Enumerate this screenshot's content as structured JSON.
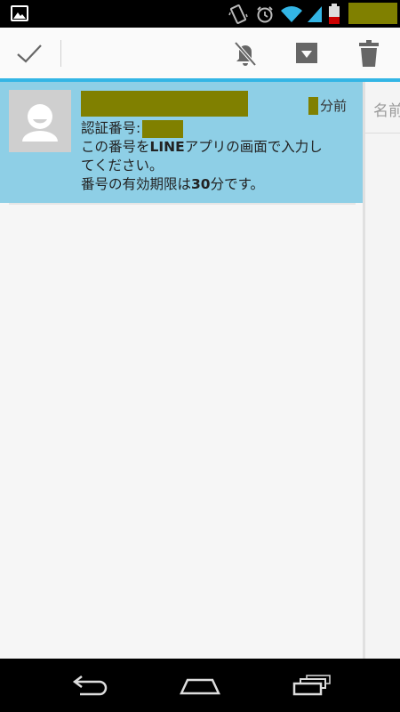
{
  "status_bar": {
    "icons": [
      "gallery-icon",
      "vibrate-icon",
      "alarm-icon",
      "wifi-icon",
      "signal-icon",
      "battery-icon"
    ],
    "colors": {
      "wifi": "#33b5e5",
      "signal": "#33b5e5",
      "battery_low": "#cc0000"
    }
  },
  "action_bar": {
    "icons": [
      "checkmark-icon",
      "mute-bell-icon",
      "archive-icon",
      "trash-icon"
    ],
    "accent_color": "#33b5e5"
  },
  "message": {
    "time_suffix": "分前",
    "code_label": "認証番号:",
    "body_line1_a": "この番号を",
    "body_line1_bold": "LINE",
    "body_line1_b": "アプリの画面で入力し",
    "body_line2": "てください。",
    "body_line3_a": "番号の有効期限は",
    "body_line3_bold": "30",
    "body_line3_b": "分です。",
    "highlight_color": "#8ecfe6"
  },
  "right_pane": {
    "name_placeholder": "名前"
  },
  "nav_bar": {
    "icons": [
      "back-icon",
      "home-icon",
      "recent-apps-icon"
    ]
  }
}
